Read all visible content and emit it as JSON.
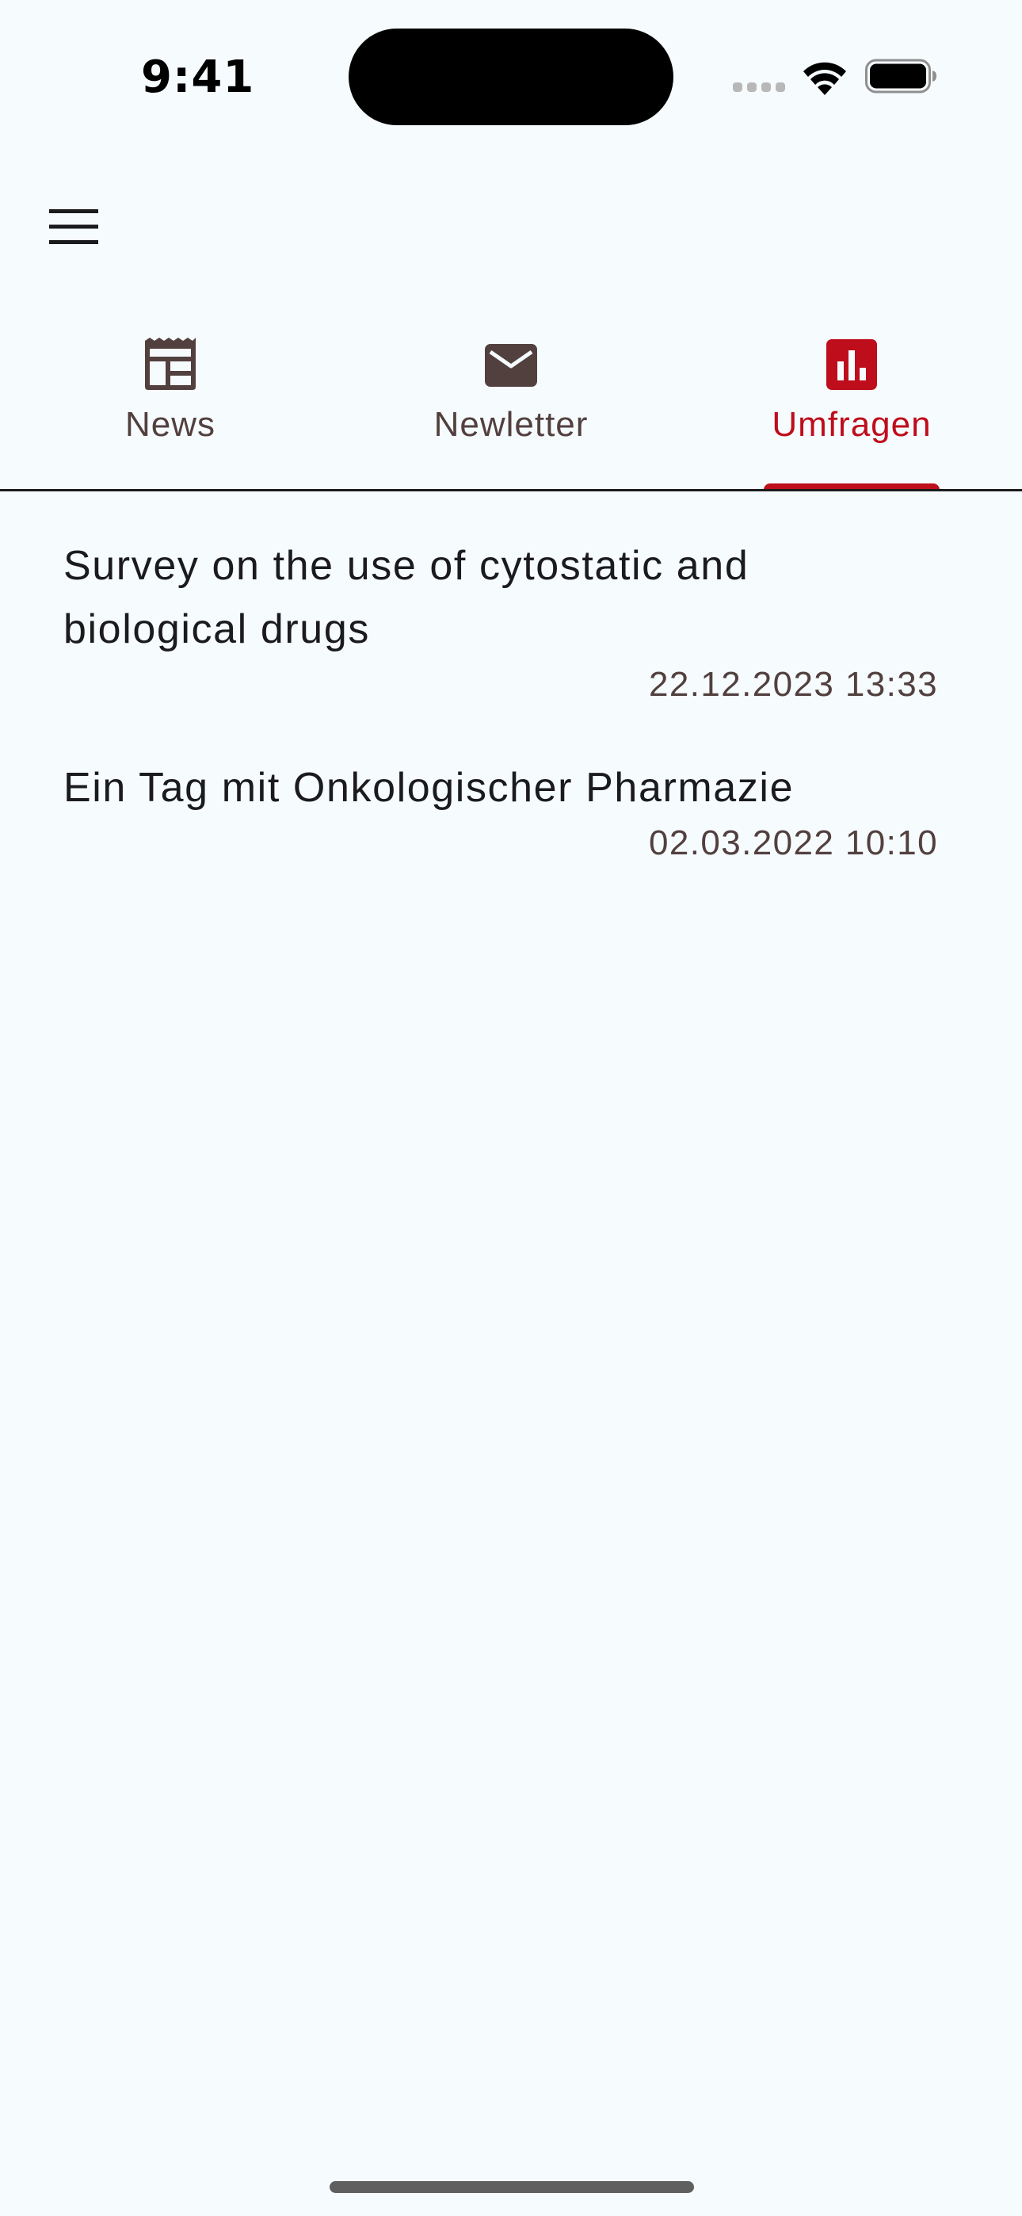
{
  "status_bar": {
    "time": "9:41"
  },
  "app_bar": {
    "menu_icon": "hamburger-menu-icon"
  },
  "tabs": [
    {
      "label": "News",
      "icon": "newspaper-icon",
      "active": false
    },
    {
      "label": "Newletter",
      "icon": "mail-icon",
      "active": false
    },
    {
      "label": "Umfragen",
      "icon": "poll-chart-icon",
      "active": true
    }
  ],
  "surveys": [
    {
      "title": "Survey on the use of cytostatic and biological drugs",
      "date": "22.12.2023 13:33"
    },
    {
      "title": "Ein Tag mit Onkologischer Pharmazie",
      "date": "02.03.2022 10:10"
    }
  ],
  "colors": {
    "background": "#f6fbfe",
    "accent": "#be0d1b",
    "icon_inactive": "#52403f",
    "text_primary": "#1b1b1d"
  }
}
